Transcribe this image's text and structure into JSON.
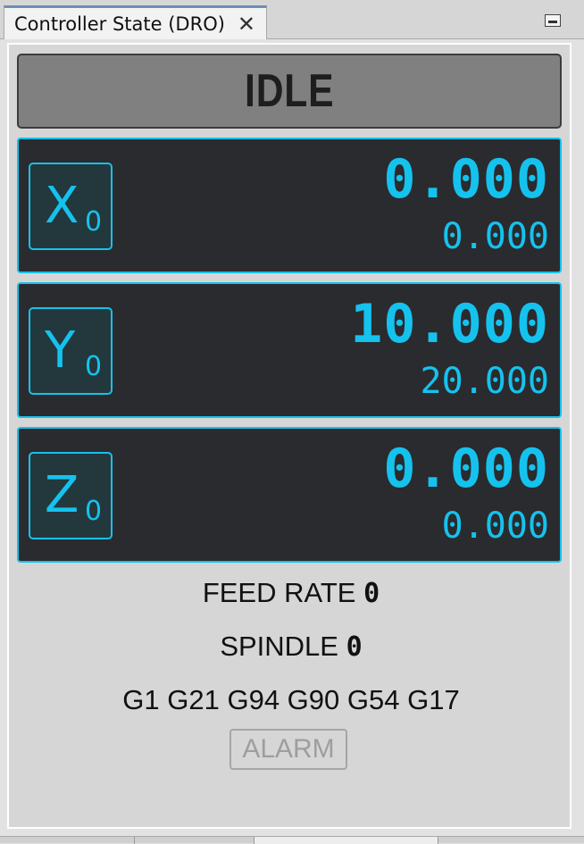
{
  "window": {
    "tab_title": "Controller State (DRO)",
    "close_glyph": "✕"
  },
  "state": {
    "label": "IDLE"
  },
  "axes": [
    {
      "letter": "X",
      "zero": "0",
      "work": "0.000",
      "machine": "0.000"
    },
    {
      "letter": "Y",
      "zero": "0",
      "work": "10.000",
      "machine": "20.000"
    },
    {
      "letter": "Z",
      "zero": "0",
      "work": "0.000",
      "machine": "0.000"
    }
  ],
  "feed": {
    "label": "FEED RATE",
    "value": "0"
  },
  "spindle": {
    "label": "SPINDLE",
    "value": "0"
  },
  "gcode_modes": "G1 G21 G94 G90 G54 G17",
  "alarm": {
    "label": "ALARM"
  },
  "colors": {
    "accent": "#15c2ee",
    "axis_bg": "#2a2b2e",
    "state_bg": "#808080",
    "panel_bg": "#d6d6d6"
  },
  "icons": {
    "close": "close-icon",
    "minimize": "minimize-icon"
  }
}
